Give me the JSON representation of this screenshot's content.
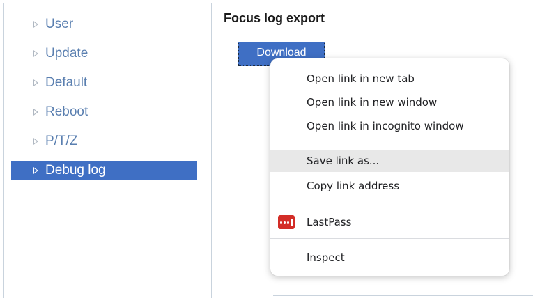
{
  "sidebar": {
    "items": [
      {
        "label": "User"
      },
      {
        "label": "Update"
      },
      {
        "label": "Default"
      },
      {
        "label": "Reboot"
      },
      {
        "label": "P/T/Z"
      },
      {
        "label": "Debug log",
        "active": true
      }
    ]
  },
  "main": {
    "title": "Focus log export",
    "download_label": "Download"
  },
  "context_menu": {
    "items": [
      {
        "label": "Open link in new tab"
      },
      {
        "label": "Open link in new window"
      },
      {
        "label": "Open link in incognito window"
      },
      {
        "label": "Save link as...",
        "highlighted": true
      },
      {
        "label": "Copy link address"
      },
      {
        "label": "LastPass",
        "icon": "lastpass-icon"
      },
      {
        "label": "Inspect"
      }
    ]
  },
  "colors": {
    "accent": "#3f6fc4",
    "nav_text": "#5a7fb0",
    "lastpass": "#d32d27"
  }
}
